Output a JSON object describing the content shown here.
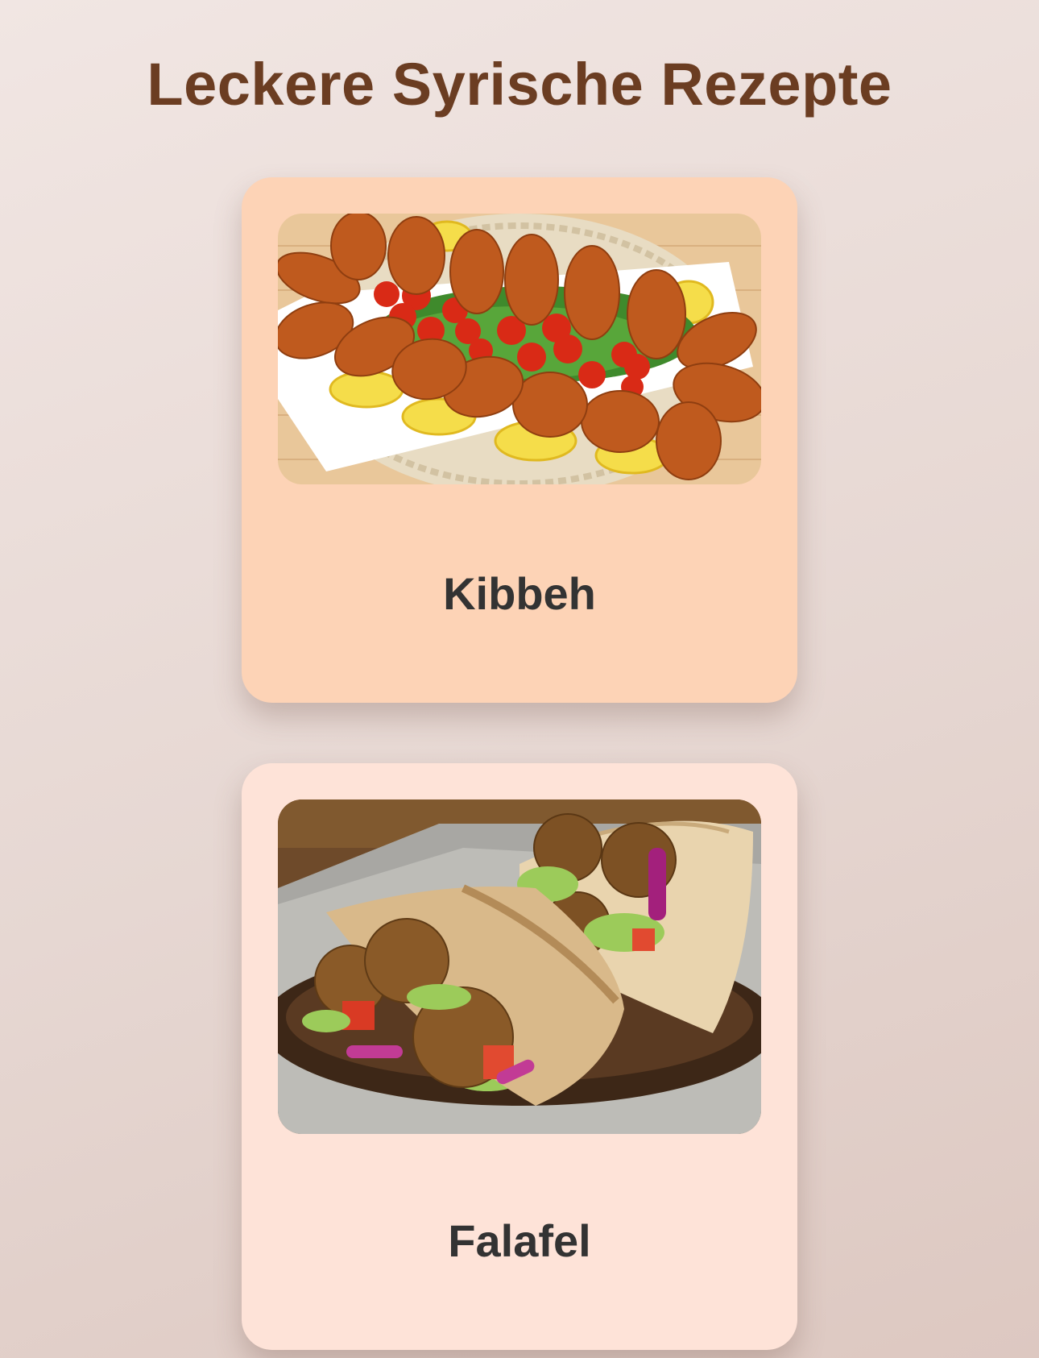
{
  "page": {
    "title": "Leckere Syrische Rezepte"
  },
  "recipes": [
    {
      "name": "Kibbeh",
      "card_color": "#fdd3b6"
    },
    {
      "name": "Falafel",
      "card_color": "#fee3d8"
    }
  ],
  "colors": {
    "title": "#6b3d22",
    "card_text": "#333333",
    "background": "#ebddd8"
  }
}
